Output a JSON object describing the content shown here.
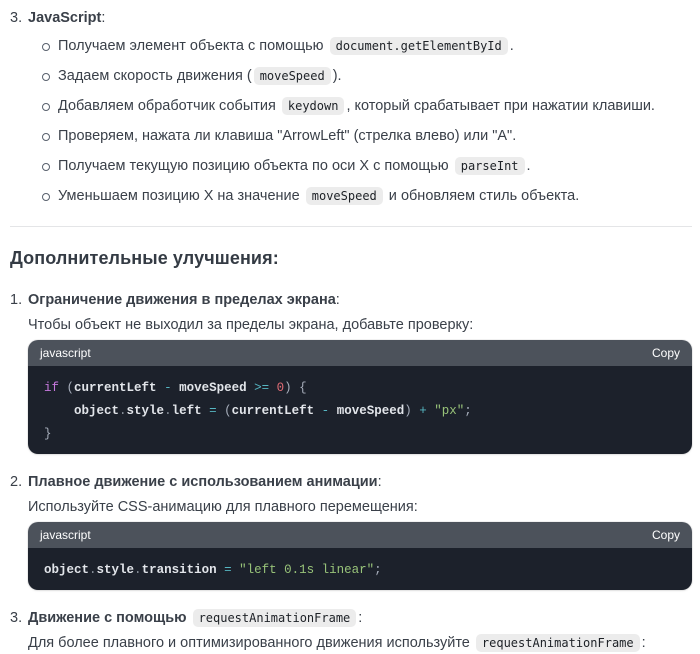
{
  "colors": {
    "text": "#3a4049",
    "heading": "#343b44",
    "divider": "#e4e5e7",
    "chip-bg": "#ececec",
    "chip-text": "#1d2126",
    "code-header-bg": "#4c525b",
    "code-header-text": "#ffffff",
    "code-bg": "#1c212b",
    "kw": "#c678dd",
    "id": "#e2e5ea",
    "num": "#e06c75",
    "str": "#98c379",
    "op": "#56b6c2",
    "pun": "#a6adba",
    "dot": "#8a929c"
  },
  "intro": {
    "marker": "3.",
    "title_segments": [
      {
        "t": "bold",
        "v": "JavaScript"
      },
      {
        "t": "text",
        "v": ":"
      }
    ],
    "bullets": [
      [
        {
          "t": "text",
          "v": "Получаем элемент объекта с помощью "
        },
        {
          "t": "code",
          "v": "document.getElementById"
        },
        {
          "t": "text",
          "v": "."
        }
      ],
      [
        {
          "t": "text",
          "v": "Задаем скорость движения ("
        },
        {
          "t": "code",
          "v": "moveSpeed"
        },
        {
          "t": "text",
          "v": ")."
        }
      ],
      [
        {
          "t": "text",
          "v": "Добавляем обработчик события "
        },
        {
          "t": "code",
          "v": "keydown"
        },
        {
          "t": "text",
          "v": ", который срабатывает при нажатии клавиши."
        }
      ],
      [
        {
          "t": "text",
          "v": "Проверяем, нажата ли клавиша \"ArrowLeft\" (стрелка влево) или \"A\"."
        }
      ],
      [
        {
          "t": "text",
          "v": "Получаем текущую позицию объекта по оси X с помощью "
        },
        {
          "t": "code",
          "v": "parseInt"
        },
        {
          "t": "text",
          "v": "."
        }
      ],
      [
        {
          "t": "text",
          "v": "Уменьшаем позицию X на значение "
        },
        {
          "t": "code",
          "v": "moveSpeed"
        },
        {
          "t": "text",
          "v": " и обновляем стиль объекта."
        }
      ]
    ]
  },
  "heading": "Дополнительные улучшения:",
  "improvements": [
    {
      "marker": "1.",
      "title_segments": [
        {
          "t": "bold",
          "v": "Ограничение движения в пределах экрана"
        },
        {
          "t": "text",
          "v": ":"
        }
      ],
      "para_segments": [
        {
          "t": "text",
          "v": "Чтобы объект не выходил за пределы экрана, добавьте проверку:"
        }
      ],
      "code_block": {
        "language": "javascript",
        "copy_label": "Copy",
        "lines": [
          [
            {
              "c": "kw",
              "v": "if"
            },
            {
              "c": "pun",
              "v": " ("
            },
            {
              "c": "id",
              "v": "currentLeft"
            },
            {
              "c": "pun",
              "v": " "
            },
            {
              "c": "op",
              "v": "-"
            },
            {
              "c": "pun",
              "v": " "
            },
            {
              "c": "id",
              "v": "moveSpeed"
            },
            {
              "c": "pun",
              "v": " "
            },
            {
              "c": "op",
              "v": ">="
            },
            {
              "c": "pun",
              "v": " "
            },
            {
              "c": "num",
              "v": "0"
            },
            {
              "c": "pun",
              "v": ") {"
            }
          ],
          [
            {
              "c": "pun",
              "v": "    "
            },
            {
              "c": "id",
              "v": "object"
            },
            {
              "c": "dot",
              "v": "."
            },
            {
              "c": "id",
              "v": "style"
            },
            {
              "c": "dot",
              "v": "."
            },
            {
              "c": "id",
              "v": "left"
            },
            {
              "c": "pun",
              "v": " "
            },
            {
              "c": "op",
              "v": "="
            },
            {
              "c": "pun",
              "v": " ("
            },
            {
              "c": "id",
              "v": "currentLeft"
            },
            {
              "c": "pun",
              "v": " "
            },
            {
              "c": "op",
              "v": "-"
            },
            {
              "c": "pun",
              "v": " "
            },
            {
              "c": "id",
              "v": "moveSpeed"
            },
            {
              "c": "pun",
              "v": ") "
            },
            {
              "c": "op",
              "v": "+"
            },
            {
              "c": "pun",
              "v": " "
            },
            {
              "c": "str",
              "v": "\"px\""
            },
            {
              "c": "pun",
              "v": ";"
            }
          ],
          [
            {
              "c": "pun",
              "v": "}"
            }
          ]
        ]
      }
    },
    {
      "marker": "2.",
      "title_segments": [
        {
          "t": "bold",
          "v": "Плавное движение с использованием анимации"
        },
        {
          "t": "text",
          "v": ":"
        }
      ],
      "para_segments": [
        {
          "t": "text",
          "v": "Используйте CSS-анимацию для плавного перемещения:"
        }
      ],
      "code_block": {
        "language": "javascript",
        "copy_label": "Copy",
        "lines": [
          [
            {
              "c": "id",
              "v": "object"
            },
            {
              "c": "dot",
              "v": "."
            },
            {
              "c": "id",
              "v": "style"
            },
            {
              "c": "dot",
              "v": "."
            },
            {
              "c": "id",
              "v": "transition"
            },
            {
              "c": "pun",
              "v": " "
            },
            {
              "c": "op",
              "v": "="
            },
            {
              "c": "pun",
              "v": " "
            },
            {
              "c": "str",
              "v": "\"left 0.1s linear\""
            },
            {
              "c": "pun",
              "v": ";"
            }
          ]
        ]
      }
    },
    {
      "marker": "3.",
      "title_segments": [
        {
          "t": "bold",
          "v": "Движение с помощью"
        },
        {
          "t": "text",
          "v": " "
        },
        {
          "t": "code",
          "v": "requestAnimationFrame"
        },
        {
          "t": "text",
          "v": ":"
        }
      ],
      "para_segments": [
        {
          "t": "text",
          "v": "Для более плавного и оптимизированного движения используйте "
        },
        {
          "t": "code",
          "v": "requestAnimationFrame"
        },
        {
          "t": "text",
          "v": ":"
        }
      ]
    }
  ]
}
